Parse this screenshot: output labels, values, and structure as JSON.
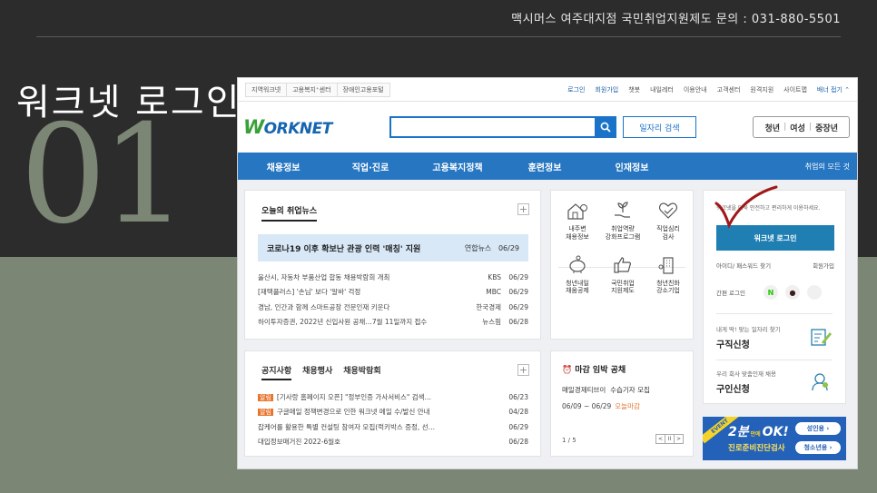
{
  "slide": {
    "contact": "맥시머스 여주대지점 국민취업지원제도 문의 : 031-880-5501",
    "title": "워크넷 로그인",
    "number": "01"
  },
  "worknet": {
    "util_left": [
      "지역워크넷",
      "고용복지⁺센터",
      "장애인고용포털"
    ],
    "util_right": [
      "로그인",
      "회원가입",
      "챗봇",
      "내일레터",
      "이용안내",
      "고객센터",
      "원격지원",
      "사이트맵"
    ],
    "banner_fold": "배너 접기 ⌃",
    "logo": {
      "w": "W",
      "rest": "ORKNET"
    },
    "search": {
      "placeholder": "",
      "job_search": "일자리 검색"
    },
    "age_tabs": [
      "청년",
      "여성",
      "중장년"
    ],
    "gnb": [
      "채용정보",
      "직업·진로",
      "고용복지정책",
      "훈련정보",
      "인재정보"
    ],
    "gnb_all": "취업의 모든 것",
    "news": {
      "tab": "오늘의 취업뉴스",
      "plus": "+",
      "headline": {
        "title": "코로나19 이후 확보난 관광 인력 '매칭' 지원",
        "source": "연합뉴스",
        "date": "06/29"
      },
      "items": [
        {
          "title": "울산시, 자동차 부품산업 합동 채용박람회 개최",
          "source": "KBS",
          "date": "06/29"
        },
        {
          "title": "[재택플러스] '손님' 보다 '알바' 걱정",
          "source": "MBC",
          "date": "06/29"
        },
        {
          "title": "경남, 인간과 함께 스마트공장 전문인재 키운다",
          "source": "한국경제",
          "date": "06/29"
        },
        {
          "title": "하이투자증권, 2022년 신입사원 공채…7월 11일까지 접수",
          "source": "뉴스핌",
          "date": "06/28"
        }
      ]
    },
    "notice": {
      "tabs": [
        "공지사항",
        "채용행사",
        "채용박람회"
      ],
      "plus": "+",
      "badge": "알림",
      "items": [
        {
          "badge": true,
          "title": "[기사랑 홈페이지 오픈] \"정부인증 가사서비스\" 검색…",
          "date": "06/23"
        },
        {
          "badge": true,
          "title": "구글메일 정책변경으로 인한 워크넷 메일 수/발신 안내",
          "date": "04/28"
        },
        {
          "badge": false,
          "title": "잡케어를 활용한 특별 컨설팅 참여자 모집(럭키박스 증정, 선…",
          "date": "06/29"
        },
        {
          "badge": false,
          "title": "대입정보매거진 2022-6월호",
          "date": "06/28"
        }
      ]
    },
    "services": [
      {
        "icon": "house-pin-icon",
        "label": "내주변\n채용정보"
      },
      {
        "icon": "plant-hand-icon",
        "label": "취업역량\n강화프로그램"
      },
      {
        "icon": "heart-check-icon",
        "label": "직업심리\n검사"
      },
      {
        "icon": "piggy-bank-icon",
        "label": "청년내일\n채움공제"
      },
      {
        "icon": "thumbs-up-icon",
        "label": "국민취업\n지원제도"
      },
      {
        "icon": "building-icon",
        "label": "청년친화\n강소기업"
      }
    ],
    "deadline": {
      "title": "마감 임박 공채",
      "company": "매일경제티브이",
      "job": "수습기자 모집",
      "period": "06/09 ~ 06/29",
      "today": "오늘마감",
      "page": "1 / 5",
      "pager": [
        "<",
        "II",
        ">"
      ]
    },
    "login": {
      "desc": "워크넷을 더욱 안전하고 편리하게 이용하세요.",
      "button": "워크넷 로그인",
      "find": "아이디/ 패스워드 찾기",
      "join": "회원가입",
      "simple": "간편 로그인",
      "sns": [
        "N",
        "●",
        ""
      ],
      "job_seek": {
        "sub": "내게 딱! 맞는 일자리 찾기",
        "main": "구직신청"
      },
      "hire": {
        "sub": "우리 회사 맞춤인재 채용",
        "main": "구인신청"
      }
    },
    "banner": {
      "event": "EVENT",
      "big": "2분",
      "small": "만에",
      "ok": "OK!",
      "sub": "진로준비진단검사",
      "pill1": "성인용 ›",
      "pill2": "청소년용 ›"
    },
    "colors": {
      "brand_blue": "#1a73c9",
      "gnb_blue": "#2776c2",
      "login_button": "#1f7fb2",
      "checkmark_red": "#a01818",
      "slide_dark": "#2c2c2c",
      "slide_sage": "#7c8675"
    }
  }
}
